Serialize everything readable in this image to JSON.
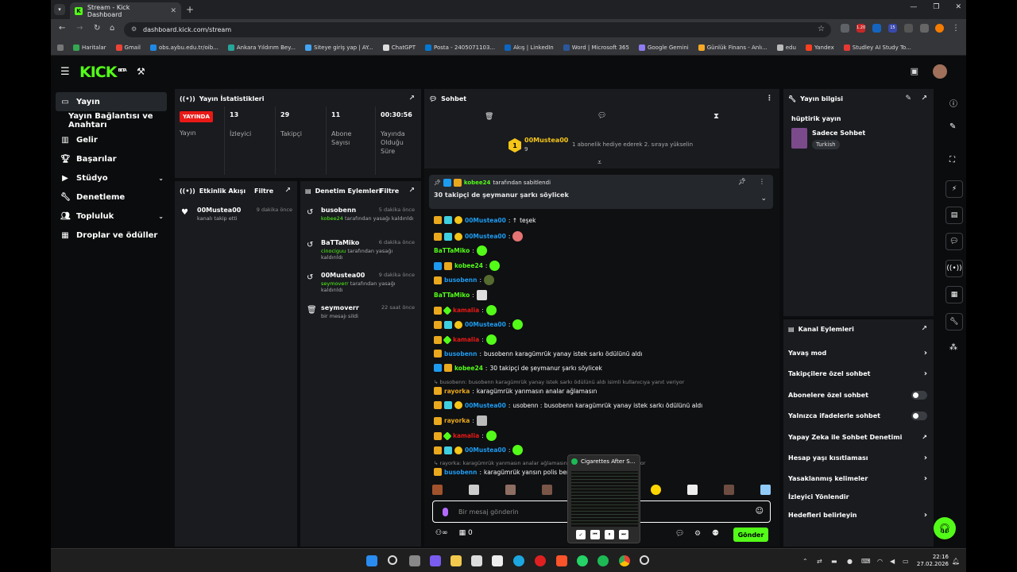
{
  "browser": {
    "tab_title": "Stream - Kick Dashboard",
    "url": "dashboard.kick.com/stream",
    "bookmarks": [
      "Haritalar",
      "Gmail",
      "obs.aybu.edu.tr/oib...",
      "Ankara Yıldırım Bey...",
      "Siteye giriş yap | AY...",
      "ChatGPT",
      "Posta - 2405071103...",
      "Akış | LinkedIn",
      "Word | Microsoft 365",
      "Google Gemini",
      "Günlük Finans - Anlı...",
      "edu",
      "Yandex",
      "Studley AI Study To..."
    ],
    "ext_badge_1": "1.20",
    "ext_badge_2": "15"
  },
  "header": {
    "logo": "KICK",
    "logo_sup": "BETA"
  },
  "sidebar": {
    "items": [
      {
        "label": "Yayın"
      },
      {
        "label": "Yayın Bağlantısı ve Anahtarı"
      },
      {
        "label": "Gelir"
      },
      {
        "label": "Başarılar"
      },
      {
        "label": "Stüdyo"
      },
      {
        "label": "Denetleme"
      },
      {
        "label": "Topluluk"
      },
      {
        "label": "Droplar ve ödüller"
      }
    ]
  },
  "stats": {
    "title": "Yayın İstatistikleri",
    "live_badge": "YAYINDA",
    "live_label": "Yayın",
    "viewers_value": "13",
    "viewers_label": "İzleyici",
    "followers_value": "29",
    "followers_label": "Takipçi",
    "subs_value": "11",
    "subs_label": "Abone Sayısı",
    "uptime_value": "00:30:56",
    "uptime_label": "Yayında Olduğu Süre"
  },
  "activity": {
    "title": "Etkinlik Akışı",
    "filter": "Filtre",
    "items": [
      {
        "name": "00Mustea00",
        "desc": "kanalı takip etti",
        "time": "9 dakika önce"
      }
    ]
  },
  "moderation": {
    "title": "Denetim Eylemleri",
    "filter": "Filtre",
    "items": [
      {
        "name": "busobenn",
        "by": "kobee24",
        "desc": "tarafından yasağı kaldırıldı",
        "time": "5 dakika önce"
      },
      {
        "name": "BaTTaMiko",
        "by": "cinociguu",
        "desc": "tarafından yasağı kaldırıldı",
        "time": "6 dakika önce"
      },
      {
        "name": "00Mustea00",
        "by": "seymoverr",
        "desc": "tarafından yasağı kaldırıldı",
        "time": "9 dakika önce"
      },
      {
        "name": "seymoverr",
        "by": "",
        "desc": "bir mesajı sildi",
        "time": "22 saat önce"
      }
    ]
  },
  "chat": {
    "title": "Sohbet",
    "top_user": "00Mustea00",
    "top_count": "9",
    "top_note": "1 abonelik hediye ederek 2. sıraya yükselin",
    "pinned_by": "kobee24",
    "pinned_suffix": "tarafından sabitlendi",
    "pinned_text": "30 takipçi de şeymanur şarkı söylicek",
    "messages": [
      {
        "user": "00Mustea00",
        "text": "teşek"
      },
      {
        "user": "00Mustea00",
        "text": ""
      },
      {
        "user": "BaTTaMiko",
        "text": ""
      },
      {
        "user": "kobee24",
        "text": ""
      },
      {
        "user": "busobenn",
        "text": ""
      },
      {
        "user": "BaTTaMiko",
        "text": ""
      },
      {
        "user": "kamalia",
        "text": ""
      },
      {
        "user": "00Mustea00",
        "text": ""
      },
      {
        "user": "kamalia",
        "text": ""
      },
      {
        "user": "busobenn",
        "text": "busobenn karagümrük yanay istek sarkı ödülünü aldı"
      },
      {
        "user": "kobee24",
        "text": "30 takipçi de şeymanur şarkı söylicek"
      },
      {
        "user": "rayorka",
        "text": "karagümrük yanmasın analar ağlamasın",
        "reply": "busobenn: busobenn karagümrük yanay istek sarkı ödülünü aldı isimli kullanıcıya yanıt veriyor"
      },
      {
        "user": "00Mustea00",
        "text": "usobenn : busobenn karagümrük yanay istek sarkı ödülünü aldı"
      },
      {
        "user": "rayorka",
        "text": ""
      },
      {
        "user": "kamalia",
        "text": ""
      },
      {
        "user": "00Mustea00",
        "text": ""
      },
      {
        "user": "busobenn",
        "text": "karagümrük yansın polis beni",
        "reply": "rayorka: karagümrük yanmasın analar ağlamasın isimli kullanıcıya yanıt veriyor"
      }
    ],
    "placeholder": "Bir mesaj gönderin",
    "gift_count": "0",
    "send": "Gönder"
  },
  "info": {
    "title": "Yayın bilgisi",
    "stream_title": "hüptirik yayın",
    "category": "Sadece Sohbet",
    "language": "Turkish"
  },
  "channel_actions": {
    "title": "Kanal Eylemleri",
    "items": [
      {
        "label": "Yavaş mod"
      },
      {
        "label": "Takipçilere özel sohbet"
      },
      {
        "label": "Abonelere özel sohbet"
      },
      {
        "label": "Yalnızca ifadelerle sohbet"
      },
      {
        "label": "Yapay Zeka ile Sohbet Denetimi"
      },
      {
        "label": "Hesap yaşı kısıtlaması"
      },
      {
        "label": "Yasaklanmış kelimeler"
      },
      {
        "label": "İzleyici Yönlendir"
      },
      {
        "label": "Hedefleri belirleyin"
      }
    ]
  },
  "spotify": {
    "title": "Cigarettes After S..."
  },
  "taskbar": {
    "time": "22:16",
    "date": "27.02.2026"
  },
  "colors": {
    "accent": "#53fc18",
    "live": "#e91916",
    "panel": "#191b1f"
  }
}
